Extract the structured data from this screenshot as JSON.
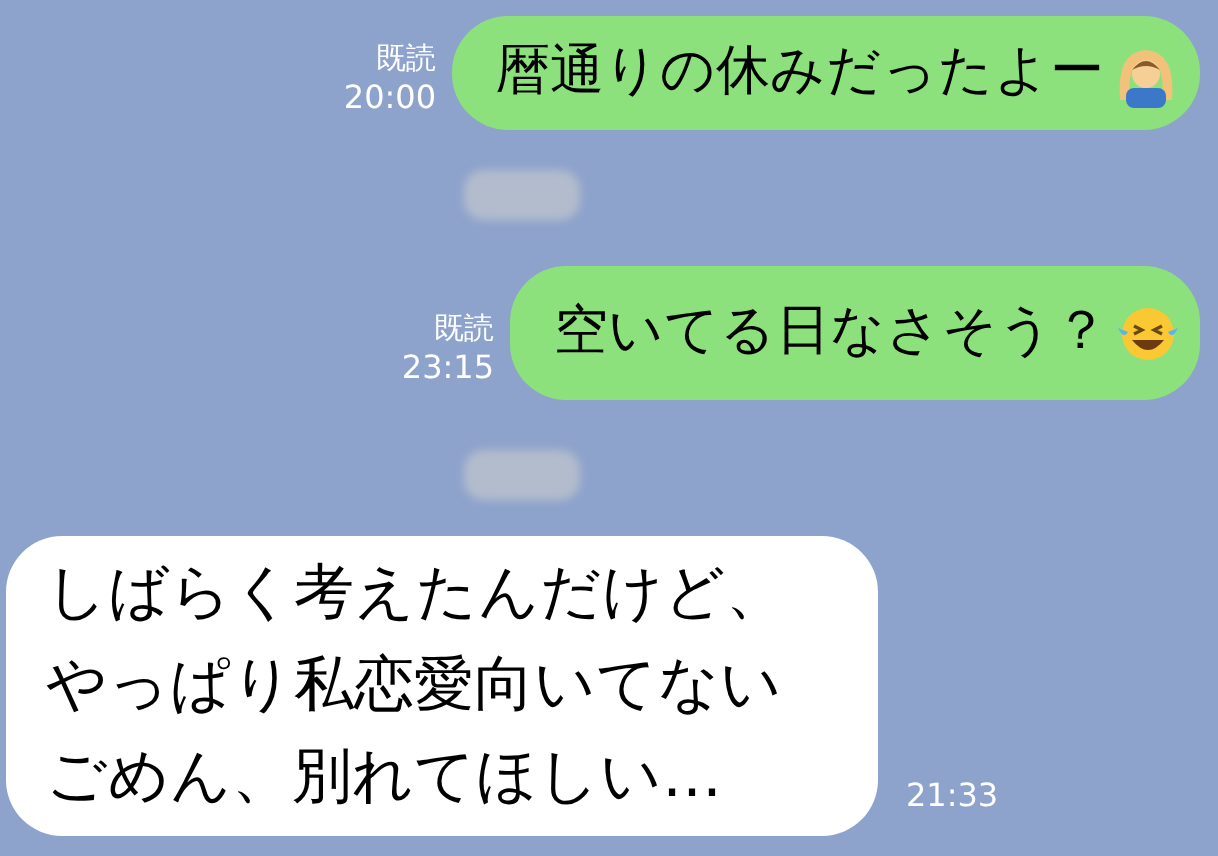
{
  "messages": [
    {
      "kind": "outgoing",
      "read_label": "既読",
      "time": "20:00",
      "text": "暦通りの休みだったよー"
    },
    {
      "kind": "redacted"
    },
    {
      "kind": "outgoing",
      "read_label": "既読",
      "time": "23:15",
      "text": "空いてる日なさそう？"
    },
    {
      "kind": "redacted"
    },
    {
      "kind": "incoming",
      "time": "21:33",
      "text": "しばらく考えたんだけど、やっぱり私恋愛向いてないごめん、別れてほしい…"
    }
  ]
}
